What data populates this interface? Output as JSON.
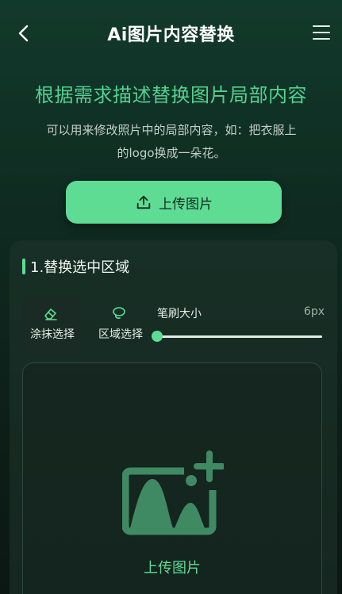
{
  "header": {
    "title": "Ai图片内容替换",
    "back_icon": "chevron-left-icon",
    "menu_icon": "hamburger-menu-icon"
  },
  "hero": {
    "headline": "根据需求描述替换图片局部内容",
    "description": "可以用来修改照片中的局部内容，如：把衣服上的logo换成一朵花。"
  },
  "upload": {
    "label": "上传图片",
    "icon": "upload-icon"
  },
  "section": {
    "title": "1.替换选中区域",
    "tools": [
      {
        "label": "涂抹选择",
        "icon": "eraser-icon",
        "selected": true
      },
      {
        "label": "区域选择",
        "icon": "lasso-icon",
        "selected": false
      }
    ],
    "brush": {
      "label": "笔刷大小",
      "value_text": "6px",
      "level": 0.0
    },
    "canvas": {
      "icon": "add-image-icon",
      "label": "上传图片"
    }
  },
  "colors": {
    "accent": "#5fdc94",
    "background": "#0f2b21"
  }
}
